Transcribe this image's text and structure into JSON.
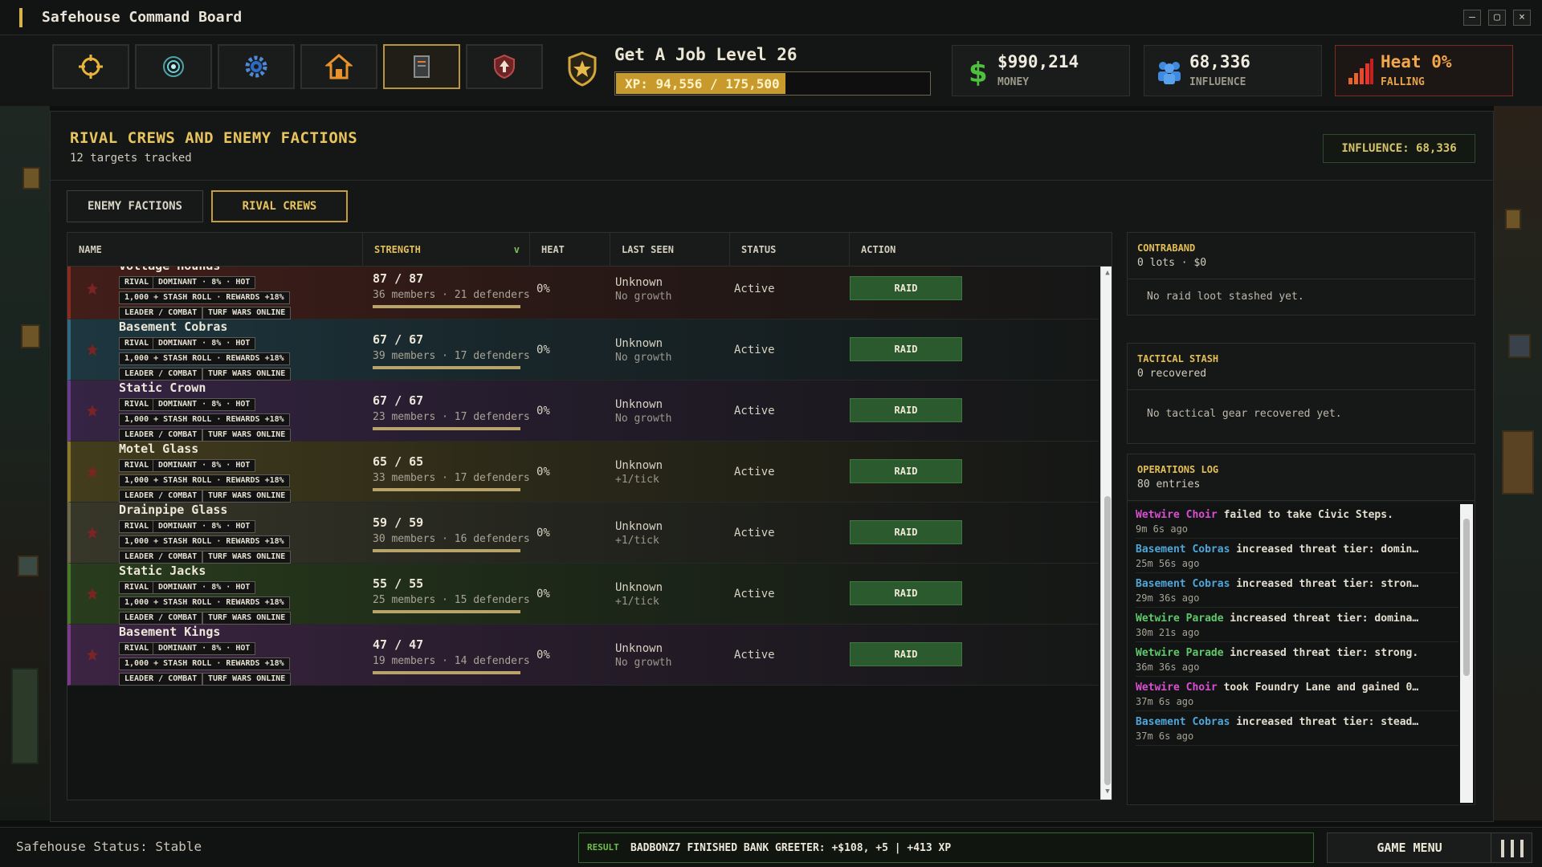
{
  "window": {
    "title": "Safehouse Command Board",
    "minimize": "–",
    "maximize": "▢",
    "close": "×"
  },
  "nav": [
    {
      "icon": "crosshair-icon"
    },
    {
      "icon": "radar-icon"
    },
    {
      "icon": "gear-icon"
    },
    {
      "icon": "safehouse-icon"
    },
    {
      "icon": "document-icon"
    },
    {
      "icon": "shield-icon"
    }
  ],
  "player": {
    "level_label": "Get A Job Level 26",
    "xp_text": "XP: 94,556 / 175,500",
    "xp_fraction": 0.539
  },
  "stats": {
    "money": {
      "value": "$990,214",
      "label": "MONEY"
    },
    "influence": {
      "value": "68,336",
      "label": "INFLUENCE"
    },
    "heat": {
      "value": "Heat 0%",
      "label": "FALLING"
    }
  },
  "panel": {
    "title": "RIVAL CREWS AND ENEMY FACTIONS",
    "subtitle": "12 targets tracked",
    "influence_box": "INFLUENCE: 68,336"
  },
  "tabs": {
    "enemy": "ENEMY FACTIONS",
    "rival": "RIVAL CREWS"
  },
  "table": {
    "headers": {
      "name": "NAME",
      "strength": "STRENGTH",
      "sort": "v",
      "heat": "HEAT",
      "last_seen": "LAST SEEN",
      "status": "STATUS",
      "action": "ACTION"
    },
    "tags": {
      "rival": "RIVAL",
      "dominant": "DOMINANT · 8% · HOT",
      "stash": "1,000 + STASH ROLL · REWARDS +18%",
      "leader": "LEADER / COMBAT",
      "turf": "TURF WARS ONLINE"
    },
    "raid_label": "RAID",
    "rows": [
      {
        "name": "Voltage Hounds",
        "strength": "87 / 87",
        "members": "36 members · 21 defenders",
        "strength_fraction": 1,
        "heat": "0%",
        "last_seen": "Unknown",
        "growth": "No growth",
        "status": "Active",
        "color": "#8a2c22"
      },
      {
        "name": "Basement Cobras",
        "strength": "67 / 67",
        "members": "39 members · 17 defenders",
        "strength_fraction": 1,
        "heat": "0%",
        "last_seen": "Unknown",
        "growth": "No growth",
        "status": "Active",
        "color": "#2f6a82"
      },
      {
        "name": "Static Crown",
        "strength": "67 / 67",
        "members": "23 members · 17 defenders",
        "strength_fraction": 1,
        "heat": "0%",
        "last_seen": "Unknown",
        "growth": "No growth",
        "status": "Active",
        "color": "#6a3c8c"
      },
      {
        "name": "Motel Glass",
        "strength": "65 / 65",
        "members": "33 members · 17 defenders",
        "strength_fraction": 1,
        "heat": "0%",
        "last_seen": "Unknown",
        "growth": "+1/tick",
        "status": "Active",
        "color": "#8c7a2c"
      },
      {
        "name": "Drainpipe Glass",
        "strength": "59 / 59",
        "members": "30 members · 16 defenders",
        "strength_fraction": 1,
        "heat": "0%",
        "last_seen": "Unknown",
        "growth": "+1/tick",
        "status": "Active",
        "color": "#6e6a4a"
      },
      {
        "name": "Static Jacks",
        "strength": "55 / 55",
        "members": "25 members · 15 defenders",
        "strength_fraction": 1,
        "heat": "0%",
        "last_seen": "Unknown",
        "growth": "+1/tick",
        "status": "Active",
        "color": "#4a7a2c"
      },
      {
        "name": "Basement Kings",
        "strength": "47 / 47",
        "members": "19 members · 14 defenders",
        "strength_fraction": 1,
        "heat": "0%",
        "last_seen": "Unknown",
        "growth": "No growth",
        "status": "Active",
        "color": "#7a3c8a"
      }
    ]
  },
  "contraband": {
    "title": "CONTRABAND",
    "sub": "0 lots · $0",
    "empty": "No raid loot stashed yet."
  },
  "tactical": {
    "title": "TACTICAL STASH",
    "sub": "0 recovered",
    "empty": "No tactical gear recovered yet."
  },
  "log": {
    "title": "OPERATIONS LOG",
    "sub": "80 entries",
    "entries": [
      {
        "actor": "Wetwire Choir",
        "actor_color": "#d94fd1",
        "text": " failed to take Civic Steps.",
        "time": "9m 6s ago"
      },
      {
        "actor": "Basement Cobras",
        "actor_color": "#4fa6d9",
        "text": " increased threat tier: domin…",
        "time": "25m 56s ago"
      },
      {
        "actor": "Basement Cobras",
        "actor_color": "#4fa6d9",
        "text": " increased threat tier: stron…",
        "time": "29m 36s ago"
      },
      {
        "actor": "Wetwire Parade",
        "actor_color": "#5fc96a",
        "text": " increased threat tier: domina…",
        "time": "30m 21s ago"
      },
      {
        "actor": "Wetwire Parade",
        "actor_color": "#5fc96a",
        "text": " increased threat tier: strong.",
        "time": "36m 36s ago"
      },
      {
        "actor": "Wetwire Choir",
        "actor_color": "#d94fd1",
        "text": " took Foundry Lane and gained 0…",
        "time": "37m 6s ago"
      },
      {
        "actor": "Basement Cobras",
        "actor_color": "#4fa6d9",
        "text": " increased threat tier: stead…",
        "time": "37m 6s ago"
      }
    ]
  },
  "footer": {
    "status": "Safehouse Status: Stable",
    "result_label": "RESULT",
    "result_text": "BADBONZ7 FINISHED BANK GREETER: +$108, +5 | +413 XP",
    "game_menu": "GAME MENU"
  }
}
